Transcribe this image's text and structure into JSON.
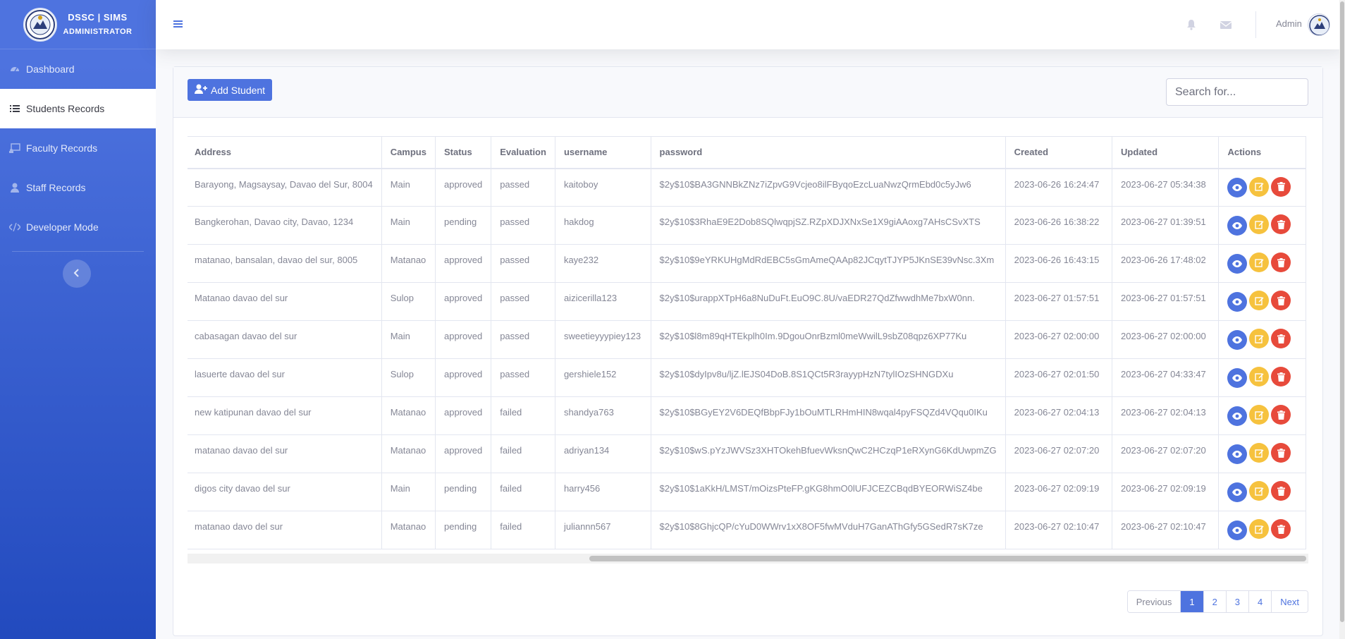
{
  "brand": {
    "title": "DSSC | SIMS",
    "subtitle": "ADMINISTRATOR"
  },
  "sidebar": {
    "items": [
      {
        "label": "Dashboard",
        "icon": "tachometer-icon",
        "active": false
      },
      {
        "label": "Students Records",
        "icon": "list-icon",
        "active": true
      },
      {
        "label": "Faculty Records",
        "icon": "chalkboard-icon",
        "active": false
      },
      {
        "label": "Staff Records",
        "icon": "user-icon",
        "active": false
      },
      {
        "label": "Developer Mode",
        "icon": "code-icon",
        "active": false
      }
    ]
  },
  "topbar": {
    "user_name": "Admin"
  },
  "toolbar": {
    "add_label": "Add Student",
    "search_placeholder": "Search for..."
  },
  "table": {
    "columns": [
      "Address",
      "Campus",
      "Status",
      "Evaluation",
      "username",
      "password",
      "Created",
      "Updated",
      "Actions"
    ],
    "rows": [
      [
        "Barayong, Magsaysay, Davao del Sur, 8004",
        "Main",
        "approved",
        "passed",
        "kaitoboy",
        "$2y$10$BA3GNNBkZNz7iZpvG9Vcjeo8ilFByqoEzcLuaNwzQrmEbd0c5yJw6",
        "2023-06-26 16:24:47",
        "2023-06-27 05:34:38"
      ],
      [
        "Bangkerohan, Davao city, Davao, 1234",
        "Main",
        "pending",
        "passed",
        "hakdog",
        "$2y$10$3RhaE9E2Dob8SQlwqpjSZ.RZpXDJXNxSe1X9giAAoxg7AHsCSvXTS",
        "2023-06-26 16:38:22",
        "2023-06-27 01:39:51"
      ],
      [
        "matanao, bansalan, davao del sur, 8005",
        "Matanao",
        "approved",
        "passed",
        "kaye232",
        "$2y$10$9eYRKUHgMdRdEBC5sGmAmeQAAp82JCqytTJYP5JKnSE39vNsc.3Xm",
        "2023-06-26 16:43:15",
        "2023-06-26 17:48:02"
      ],
      [
        "Matanao davao del sur",
        "Sulop",
        "approved",
        "passed",
        "aizicerilla123",
        "$2y$10$urappXTpH6a8NuDuFt.EuO9C.8U/vaEDR27QdZfwwdhMe7bxW0nn.",
        "2023-06-27 01:57:51",
        "2023-06-27 01:57:51"
      ],
      [
        "cabasagan davao del sur",
        "Main",
        "approved",
        "passed",
        "sweetieyyypiey123",
        "$2y$10$l8m89qHTEkplh0Im.9DgouOnrBzml0meWwilL9sbZ08qpz6XP77Ku",
        "2023-06-27 02:00:00",
        "2023-06-27 02:00:00"
      ],
      [
        "lasuerte davao del sur",
        "Sulop",
        "approved",
        "passed",
        "gershiele152",
        "$2y$10$dyIpv8u/ljZ.lEJS04DoB.8S1QCt5R3rayypHzN7tylIOzSHNGDXu",
        "2023-06-27 02:01:50",
        "2023-06-27 04:33:47"
      ],
      [
        "new katipunan davao del sur",
        "Matanao",
        "approved",
        "failed",
        "shandya763",
        "$2y$10$BGyEY2V6DEQfBbpFJy1bOuMTLRHmHIN8wqal4pyFSQZd4VQqu0IKu",
        "2023-06-27 02:04:13",
        "2023-06-27 02:04:13"
      ],
      [
        "matanao davao del sur",
        "Matanao",
        "approved",
        "failed",
        "adriyan134",
        "$2y$10$wS.pYzJWVSz3XHTOkehBfuevWksnQwC2HCzqP1eRXynG6KdUwpmZG",
        "2023-06-27 02:07:20",
        "2023-06-27 02:07:20"
      ],
      [
        "digos city davao del sur",
        "Main",
        "pending",
        "failed",
        "harry456",
        "$2y$10$1aKkH/LMST/mOizsPteFP.gKG8hmO0lUFJCEZCBqdBYEORWiSZ4be",
        "2023-06-27 02:09:19",
        "2023-06-27 02:09:19"
      ],
      [
        "matanao davo del sur",
        "Matanao",
        "pending",
        "failed",
        "juliannn567",
        "$2y$10$8GhjcQP/cYuD0WWrv1xX8OF5fwMVduH7GanAThGfy5GSedR7sK7ze",
        "2023-06-27 02:10:47",
        "2023-06-27 02:10:47"
      ]
    ]
  },
  "pagination": {
    "previous": "Previous",
    "pages": [
      "1",
      "2",
      "3",
      "4"
    ],
    "current": "1",
    "next": "Next"
  },
  "colors": {
    "primary": "#4e73df",
    "warning": "#f6c23e",
    "danger": "#e74a3b"
  }
}
